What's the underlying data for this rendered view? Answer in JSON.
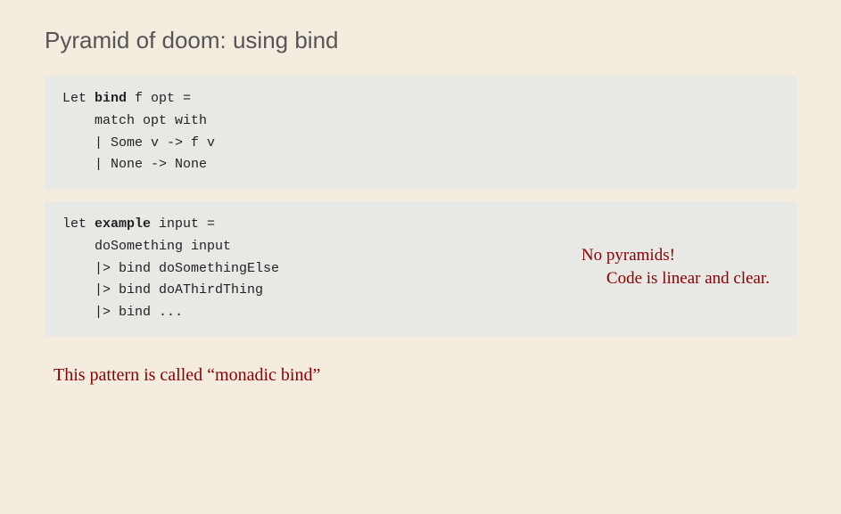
{
  "title": "Pyramid of doom: using bind",
  "block1": {
    "lines": [
      {
        "parts": [
          {
            "text": "Let ",
            "bold": false
          },
          {
            "text": "bind",
            "bold": true
          },
          {
            "text": " f opt =",
            "bold": false
          }
        ]
      },
      {
        "parts": [
          {
            "text": "    match opt with",
            "bold": false
          }
        ]
      },
      {
        "parts": [
          {
            "text": "    | Some v -> f v",
            "bold": false
          }
        ]
      },
      {
        "parts": [
          {
            "text": "    | None -> None",
            "bold": false
          }
        ]
      }
    ]
  },
  "block2": {
    "lines": [
      {
        "parts": [
          {
            "text": "let ",
            "bold": false
          },
          {
            "text": "example",
            "bold": true
          },
          {
            "text": " input =",
            "bold": false
          }
        ]
      },
      {
        "parts": [
          {
            "text": "    doSomething input",
            "bold": false
          }
        ]
      },
      {
        "parts": [
          {
            "text": "    |> bind doSomethingElse",
            "bold": false
          }
        ]
      },
      {
        "parts": [
          {
            "text": "    |> bind doAThirdThing",
            "bold": false
          }
        ]
      },
      {
        "parts": [
          {
            "text": "    |> bind ...",
            "bold": false
          }
        ]
      }
    ]
  },
  "annotations": {
    "line1": "No pyramids!",
    "line2": "Code is linear and clear."
  },
  "bottom_note": "This pattern is called “monadic bind”"
}
